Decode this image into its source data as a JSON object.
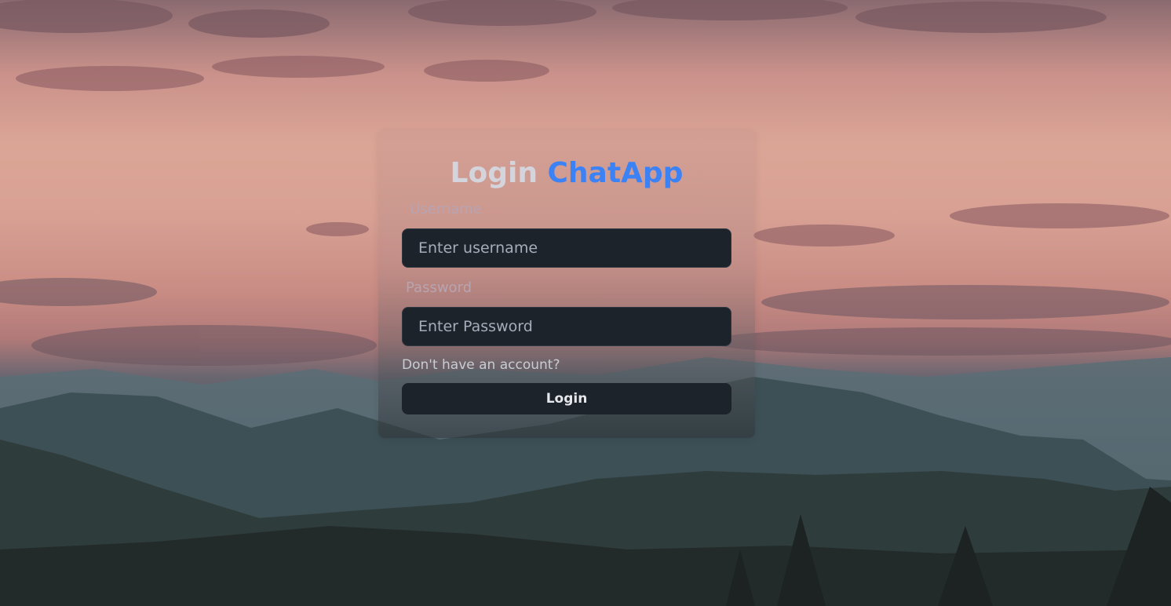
{
  "title": {
    "prefix": "Login",
    "brand": "ChatApp"
  },
  "form": {
    "username_label": "Username",
    "username_placeholder": "Enter username",
    "username_value": "",
    "password_label": "Password",
    "password_placeholder": "Enter Password",
    "password_value": "",
    "signup_link": "Don't have an account?",
    "submit_label": "Login"
  },
  "colors": {
    "brand": "#3b82f6",
    "input_background": "#1d232a",
    "button_background": "#1d232a"
  },
  "background": {
    "description_icon": "mountain-sunset-image"
  }
}
